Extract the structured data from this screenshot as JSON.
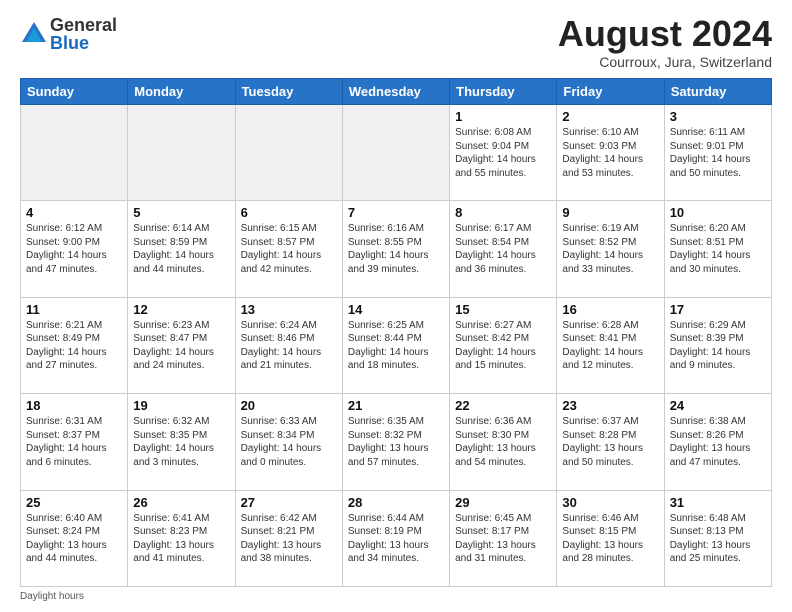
{
  "logo": {
    "general": "General",
    "blue": "Blue"
  },
  "title": "August 2024",
  "location": "Courroux, Jura, Switzerland",
  "days_of_week": [
    "Sunday",
    "Monday",
    "Tuesday",
    "Wednesday",
    "Thursday",
    "Friday",
    "Saturday"
  ],
  "footer": "Daylight hours",
  "weeks": [
    [
      {
        "day": "",
        "empty": true
      },
      {
        "day": "",
        "empty": true
      },
      {
        "day": "",
        "empty": true
      },
      {
        "day": "",
        "empty": true
      },
      {
        "day": "1",
        "info": "Sunrise: 6:08 AM\nSunset: 9:04 PM\nDaylight: 14 hours\nand 55 minutes."
      },
      {
        "day": "2",
        "info": "Sunrise: 6:10 AM\nSunset: 9:03 PM\nDaylight: 14 hours\nand 53 minutes."
      },
      {
        "day": "3",
        "info": "Sunrise: 6:11 AM\nSunset: 9:01 PM\nDaylight: 14 hours\nand 50 minutes."
      }
    ],
    [
      {
        "day": "4",
        "info": "Sunrise: 6:12 AM\nSunset: 9:00 PM\nDaylight: 14 hours\nand 47 minutes."
      },
      {
        "day": "5",
        "info": "Sunrise: 6:14 AM\nSunset: 8:59 PM\nDaylight: 14 hours\nand 44 minutes."
      },
      {
        "day": "6",
        "info": "Sunrise: 6:15 AM\nSunset: 8:57 PM\nDaylight: 14 hours\nand 42 minutes."
      },
      {
        "day": "7",
        "info": "Sunrise: 6:16 AM\nSunset: 8:55 PM\nDaylight: 14 hours\nand 39 minutes."
      },
      {
        "day": "8",
        "info": "Sunrise: 6:17 AM\nSunset: 8:54 PM\nDaylight: 14 hours\nand 36 minutes."
      },
      {
        "day": "9",
        "info": "Sunrise: 6:19 AM\nSunset: 8:52 PM\nDaylight: 14 hours\nand 33 minutes."
      },
      {
        "day": "10",
        "info": "Sunrise: 6:20 AM\nSunset: 8:51 PM\nDaylight: 14 hours\nand 30 minutes."
      }
    ],
    [
      {
        "day": "11",
        "info": "Sunrise: 6:21 AM\nSunset: 8:49 PM\nDaylight: 14 hours\nand 27 minutes."
      },
      {
        "day": "12",
        "info": "Sunrise: 6:23 AM\nSunset: 8:47 PM\nDaylight: 14 hours\nand 24 minutes."
      },
      {
        "day": "13",
        "info": "Sunrise: 6:24 AM\nSunset: 8:46 PM\nDaylight: 14 hours\nand 21 minutes."
      },
      {
        "day": "14",
        "info": "Sunrise: 6:25 AM\nSunset: 8:44 PM\nDaylight: 14 hours\nand 18 minutes."
      },
      {
        "day": "15",
        "info": "Sunrise: 6:27 AM\nSunset: 8:42 PM\nDaylight: 14 hours\nand 15 minutes."
      },
      {
        "day": "16",
        "info": "Sunrise: 6:28 AM\nSunset: 8:41 PM\nDaylight: 14 hours\nand 12 minutes."
      },
      {
        "day": "17",
        "info": "Sunrise: 6:29 AM\nSunset: 8:39 PM\nDaylight: 14 hours\nand 9 minutes."
      }
    ],
    [
      {
        "day": "18",
        "info": "Sunrise: 6:31 AM\nSunset: 8:37 PM\nDaylight: 14 hours\nand 6 minutes."
      },
      {
        "day": "19",
        "info": "Sunrise: 6:32 AM\nSunset: 8:35 PM\nDaylight: 14 hours\nand 3 minutes."
      },
      {
        "day": "20",
        "info": "Sunrise: 6:33 AM\nSunset: 8:34 PM\nDaylight: 14 hours\nand 0 minutes."
      },
      {
        "day": "21",
        "info": "Sunrise: 6:35 AM\nSunset: 8:32 PM\nDaylight: 13 hours\nand 57 minutes."
      },
      {
        "day": "22",
        "info": "Sunrise: 6:36 AM\nSunset: 8:30 PM\nDaylight: 13 hours\nand 54 minutes."
      },
      {
        "day": "23",
        "info": "Sunrise: 6:37 AM\nSunset: 8:28 PM\nDaylight: 13 hours\nand 50 minutes."
      },
      {
        "day": "24",
        "info": "Sunrise: 6:38 AM\nSunset: 8:26 PM\nDaylight: 13 hours\nand 47 minutes."
      }
    ],
    [
      {
        "day": "25",
        "info": "Sunrise: 6:40 AM\nSunset: 8:24 PM\nDaylight: 13 hours\nand 44 minutes."
      },
      {
        "day": "26",
        "info": "Sunrise: 6:41 AM\nSunset: 8:23 PM\nDaylight: 13 hours\nand 41 minutes."
      },
      {
        "day": "27",
        "info": "Sunrise: 6:42 AM\nSunset: 8:21 PM\nDaylight: 13 hours\nand 38 minutes."
      },
      {
        "day": "28",
        "info": "Sunrise: 6:44 AM\nSunset: 8:19 PM\nDaylight: 13 hours\nand 34 minutes."
      },
      {
        "day": "29",
        "info": "Sunrise: 6:45 AM\nSunset: 8:17 PM\nDaylight: 13 hours\nand 31 minutes."
      },
      {
        "day": "30",
        "info": "Sunrise: 6:46 AM\nSunset: 8:15 PM\nDaylight: 13 hours\nand 28 minutes."
      },
      {
        "day": "31",
        "info": "Sunrise: 6:48 AM\nSunset: 8:13 PM\nDaylight: 13 hours\nand 25 minutes."
      }
    ]
  ]
}
